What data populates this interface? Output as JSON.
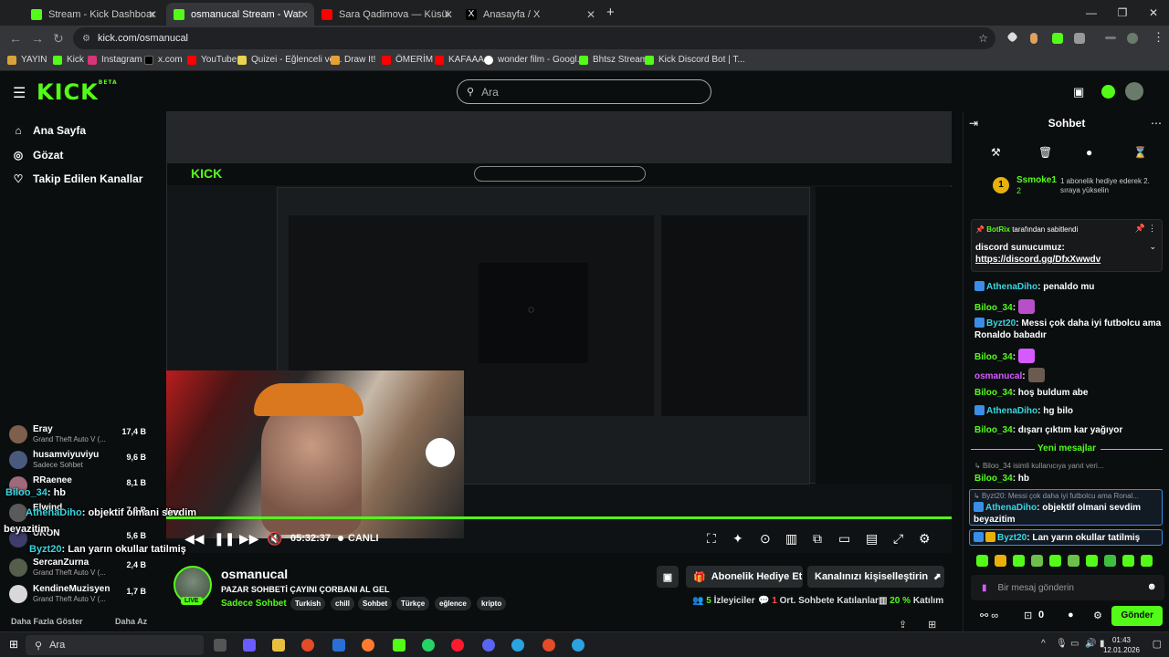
{
  "browser": {
    "tabs": [
      {
        "label": "Stream - Kick Dashboard",
        "color": "#53fc18"
      },
      {
        "label": "osmanucal Stream - Watch Live",
        "color": "#53fc18"
      },
      {
        "label": "Sara Qadimova — Küsüb Getdi",
        "color": "#ff0000"
      },
      {
        "label": "Anasayfa / X",
        "color": "#000000"
      }
    ],
    "url": "kick.com/osmanucal",
    "bookmarks": [
      "YAYIN",
      "Kick",
      "Instagram",
      "x.com",
      "YouTube",
      "Quizei - Eğlenceli ve...",
      "Draw It!",
      "ÖMERİM",
      "KAFAAA",
      "wonder film - Googl...",
      "Bhtsz Stream",
      "Kick Discord Bot | T..."
    ]
  },
  "header": {
    "logo": "KICK",
    "logo_sup": "BETA",
    "search_placeholder": "Ara"
  },
  "sidebar": {
    "nav": [
      "Ana Sayfa",
      "Gözat",
      "Takip Edilen Kanallar"
    ],
    "channels": [
      {
        "name": "Eray",
        "game": "Grand Theft Auto V (...",
        "count": "17,4 B"
      },
      {
        "name": "husamviyuviyu",
        "game": "Sadece Sohbet",
        "count": "9,6 B"
      },
      {
        "name": "RRaenee",
        "game": "",
        "count": "8,1 B"
      },
      {
        "name": "Elwind",
        "game": "",
        "count": "7,2 B"
      },
      {
        "name": "UKON",
        "game": "",
        "count": "5,6 B"
      },
      {
        "name": "SercanZurna",
        "game": "Grand Theft Auto V (...",
        "count": "2,4 B"
      },
      {
        "name": "KendineMuzisyen",
        "game": "Grand Theft Auto V (...",
        "count": "1,7 B"
      }
    ],
    "footer_more": "Daha Fazla Göster",
    "footer_less": "Daha Az"
  },
  "overlay_chat": [
    {
      "user": "Biloo_34",
      "text": ": hb"
    },
    {
      "user": "AthenaDiho",
      "text": ": objektif olmani sevdim"
    },
    {
      "user": "",
      "text": "beyazitim"
    },
    {
      "user": "Byzt20",
      "text": ": Lan yarın okullar tatilmiş"
    }
  ],
  "player": {
    "elapsed": "05:32:37",
    "live_label": "CANLI"
  },
  "channel": {
    "name": "osmanucal",
    "live_badge": "LIVE",
    "title": "PAZAR SOHBETİ ÇAYINI ÇORBANI AL GEL",
    "category": "Sadece Sohbet",
    "tags": [
      "Turkish",
      "chill",
      "Sohbet",
      "Türkçe",
      "eğlence",
      "kripto"
    ],
    "gift_button": "Abonelik Hediye Et",
    "customize_button": "Kanalınızı kişiselleştirin",
    "viewers": "5",
    "viewers_label": "İzleyiciler",
    "avg_chatters": "1",
    "avg_chatters_label": "Ort. Sohbete Katılanlar",
    "participation": "20 %",
    "participation_label": "Katılım"
  },
  "chat": {
    "title": "Sohbet",
    "gift_number": "1",
    "gift_user": "Ssmoke1",
    "gift_count": "2",
    "gift_text": "1 abonelik hediye ederek 2. sıraya yükselin",
    "pinned_by": "BotRix",
    "pinned_by_suffix": "tarafından sabitlendi",
    "pinned_line1": "discord sunucumuz:",
    "pinned_link": "https://discord.gg/DfxXwwdv",
    "messages": [
      {
        "user": "AthenaDiho",
        "text": ": penaldo mu"
      },
      {
        "user": "Biloo_34",
        "text": ":"
      },
      {
        "user": "Byzt20",
        "text": ": Messi çok daha iyi futbolcu ama Ronaldo babadır"
      },
      {
        "user": "Biloo_34",
        "text": ":"
      },
      {
        "user": "osmanucal",
        "text": ":"
      },
      {
        "user": "Biloo_34",
        "text": ": hoş buldum abe"
      },
      {
        "user": "AthenaDiho",
        "text": ": hg bilo"
      },
      {
        "user": "Biloo_34",
        "text": ": dışarı çıktım kar yağıyor"
      }
    ],
    "new_messages": "Yeni mesajlar",
    "reply1": "Biloo_34 isimli kullanıcıya yanıt veri...",
    "msg_after1_user": "Biloo_34",
    "msg_after1_text": ": hb",
    "reply2": "Byzt20: Messi çok daha iyi futbolcu ama Ronal...",
    "msg_after2_user": "AthenaDiho",
    "msg_after2_text": ": objektif olmani sevdim beyazitim",
    "msg_after3_user": "Byzt20",
    "msg_after3_text": ": Lan yarın okullar tatilmiş",
    "input_placeholder": "Bir mesaj gönderin",
    "points": "0",
    "send_label": "Gönder"
  },
  "taskbar": {
    "search": "Ara",
    "time": "01:43",
    "date": "12.01.2026"
  }
}
